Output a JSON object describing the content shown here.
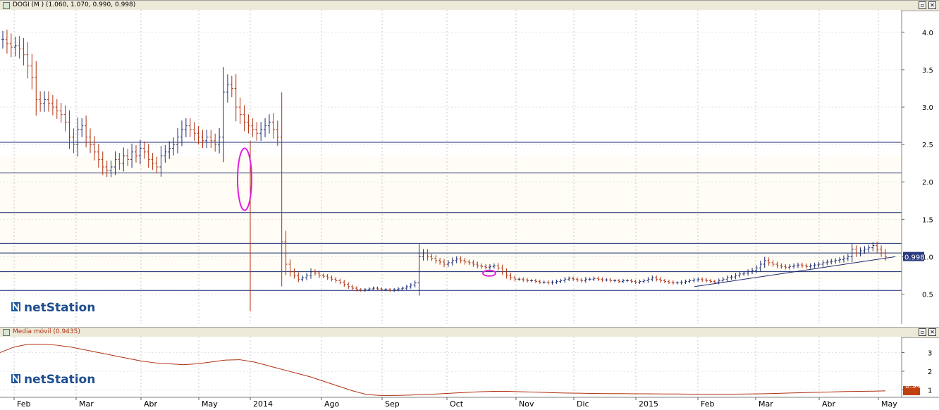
{
  "top_panel": {
    "title": "DOGI (M ) (1.060, 1.070, 0.990, 0.998)",
    "restore_glyph": "▫",
    "close_glyph": "✕",
    "watermark": "netStation",
    "last_value_label": "0.998"
  },
  "bottom_panel": {
    "title": "Media móvil (0.9435)",
    "restore_glyph": "▫",
    "close_glyph": "✕",
    "watermark": "netStation",
    "last_value_label": "0.94"
  },
  "chart_data": [
    {
      "type": "bar",
      "style": "ohlc",
      "title": "DOGI (M ) (1.060, 1.070, 0.990, 0.998)",
      "last": 0.998,
      "ylim": [
        0.1,
        4.3
      ],
      "yticks": [
        0.5,
        1.0,
        1.5,
        2.0,
        2.5,
        3.0,
        3.5,
        4.0
      ],
      "ytick_labels": [
        "0.5",
        "1.0",
        "1.5",
        "2.0",
        "2.5",
        "3.0",
        "3.5",
        "4.0"
      ],
      "x_labels": [
        "Feb",
        "Mar",
        "Abr",
        "May",
        "2014",
        "Ago",
        "Sep",
        "Oct",
        "Nov",
        "Dic",
        "2015",
        "Feb",
        "Mar",
        "Abr",
        "May"
      ],
      "bars_per_label": [
        9,
        11,
        11,
        8,
        12,
        11,
        11,
        11,
        10,
        11,
        11,
        10,
        11,
        9
      ],
      "horizontal_lines": [
        2.53,
        2.12,
        1.59,
        1.18,
        1.05,
        0.8,
        0.55
      ],
      "trendline": [
        [
          0.6,
          0
        ],
        [
          1.0,
          1
        ]
      ],
      "closes": [
        3.9,
        3.85,
        3.8,
        3.82,
        3.78,
        3.7,
        3.55,
        3.4,
        3.1,
        3.05,
        3.1,
        3.05,
        3.0,
        2.95,
        2.9,
        2.8,
        2.6,
        2.5,
        2.7,
        2.75,
        2.6,
        2.5,
        2.4,
        2.3,
        2.2,
        2.15,
        2.2,
        2.3,
        2.25,
        2.35,
        2.3,
        2.4,
        2.35,
        2.45,
        2.4,
        2.3,
        2.25,
        2.2,
        2.35,
        2.4,
        2.45,
        2.5,
        2.6,
        2.7,
        2.75,
        2.7,
        2.65,
        2.6,
        2.55,
        2.6,
        2.55,
        2.5,
        2.6,
        3.2,
        3.3,
        3.25,
        3.0,
        2.9,
        2.8,
        2.75,
        2.7,
        2.65,
        2.7,
        2.75,
        2.8,
        2.7,
        2.6,
        1.2,
        0.9,
        0.8,
        0.75,
        0.7,
        0.72,
        0.75,
        0.8,
        0.78,
        0.75,
        0.74,
        0.72,
        0.7,
        0.68,
        0.66,
        0.63,
        0.6,
        0.58,
        0.56,
        0.55,
        0.56,
        0.57,
        0.58,
        0.57,
        0.56,
        0.56,
        0.55,
        0.56,
        0.57,
        0.58,
        0.6,
        0.62,
        0.65,
        1.0,
        1.05,
        1.0,
        0.98,
        0.95,
        0.93,
        0.9,
        0.92,
        0.95,
        0.97,
        0.95,
        0.93,
        0.92,
        0.9,
        0.88,
        0.87,
        0.86,
        0.87,
        0.88,
        0.85,
        0.8,
        0.75,
        0.72,
        0.7,
        0.7,
        0.69,
        0.68,
        0.68,
        0.67,
        0.66,
        0.66,
        0.65,
        0.66,
        0.67,
        0.68,
        0.7,
        0.71,
        0.7,
        0.69,
        0.68,
        0.7,
        0.7,
        0.71,
        0.7,
        0.69,
        0.69,
        0.68,
        0.68,
        0.67,
        0.68,
        0.68,
        0.67,
        0.66,
        0.67,
        0.68,
        0.7,
        0.72,
        0.7,
        0.68,
        0.67,
        0.66,
        0.65,
        0.65,
        0.66,
        0.67,
        0.68,
        0.69,
        0.7,
        0.69,
        0.68,
        0.67,
        0.66,
        0.68,
        0.7,
        0.72,
        0.73,
        0.75,
        0.77,
        0.78,
        0.8,
        0.82,
        0.85,
        0.9,
        0.95,
        0.92,
        0.9,
        0.88,
        0.87,
        0.86,
        0.87,
        0.88,
        0.89,
        0.88,
        0.87,
        0.88,
        0.89,
        0.9,
        0.92,
        0.93,
        0.94,
        0.95,
        0.96,
        0.98,
        1.0,
        1.1,
        1.05,
        1.08,
        1.1,
        1.12,
        1.15,
        1.1,
        1.05,
        0.998
      ]
    },
    {
      "type": "line",
      "title": "Media móvil (0.9435)",
      "last": 0.94,
      "ylim": [
        0.6,
        3.7
      ],
      "yticks": [
        1,
        2,
        3
      ],
      "ytick_labels": [
        "1",
        "2",
        "3"
      ],
      "x": [
        0,
        20,
        40,
        60,
        80,
        100,
        120,
        140,
        160,
        180,
        200,
        220,
        240,
        260,
        280,
        300,
        320,
        340,
        360,
        380,
        400,
        420,
        440,
        460,
        480,
        500,
        520,
        540,
        560,
        580,
        600,
        620,
        640,
        660,
        680,
        700,
        720,
        740,
        760,
        780,
        800,
        820,
        840,
        860,
        880,
        900,
        920,
        940,
        960,
        980,
        1000,
        1020,
        1040,
        1060,
        1080,
        1100,
        1120,
        1140,
        1160,
        1180,
        1200,
        1220,
        1240,
        1256
      ],
      "values": [
        3.0,
        3.3,
        3.45,
        3.45,
        3.4,
        3.3,
        3.15,
        3.0,
        2.85,
        2.7,
        2.55,
        2.45,
        2.4,
        2.35,
        2.4,
        2.5,
        2.6,
        2.62,
        2.5,
        2.3,
        2.1,
        1.9,
        1.7,
        1.45,
        1.2,
        0.95,
        0.75,
        0.7,
        0.7,
        0.72,
        0.75,
        0.78,
        0.82,
        0.86,
        0.9,
        0.92,
        0.92,
        0.9,
        0.88,
        0.85,
        0.83,
        0.82,
        0.81,
        0.8,
        0.8,
        0.79,
        0.79,
        0.78,
        0.78,
        0.77,
        0.77,
        0.77,
        0.77,
        0.78,
        0.79,
        0.81,
        0.83,
        0.85,
        0.87,
        0.89,
        0.91,
        0.92,
        0.93,
        0.9435
      ]
    }
  ]
}
